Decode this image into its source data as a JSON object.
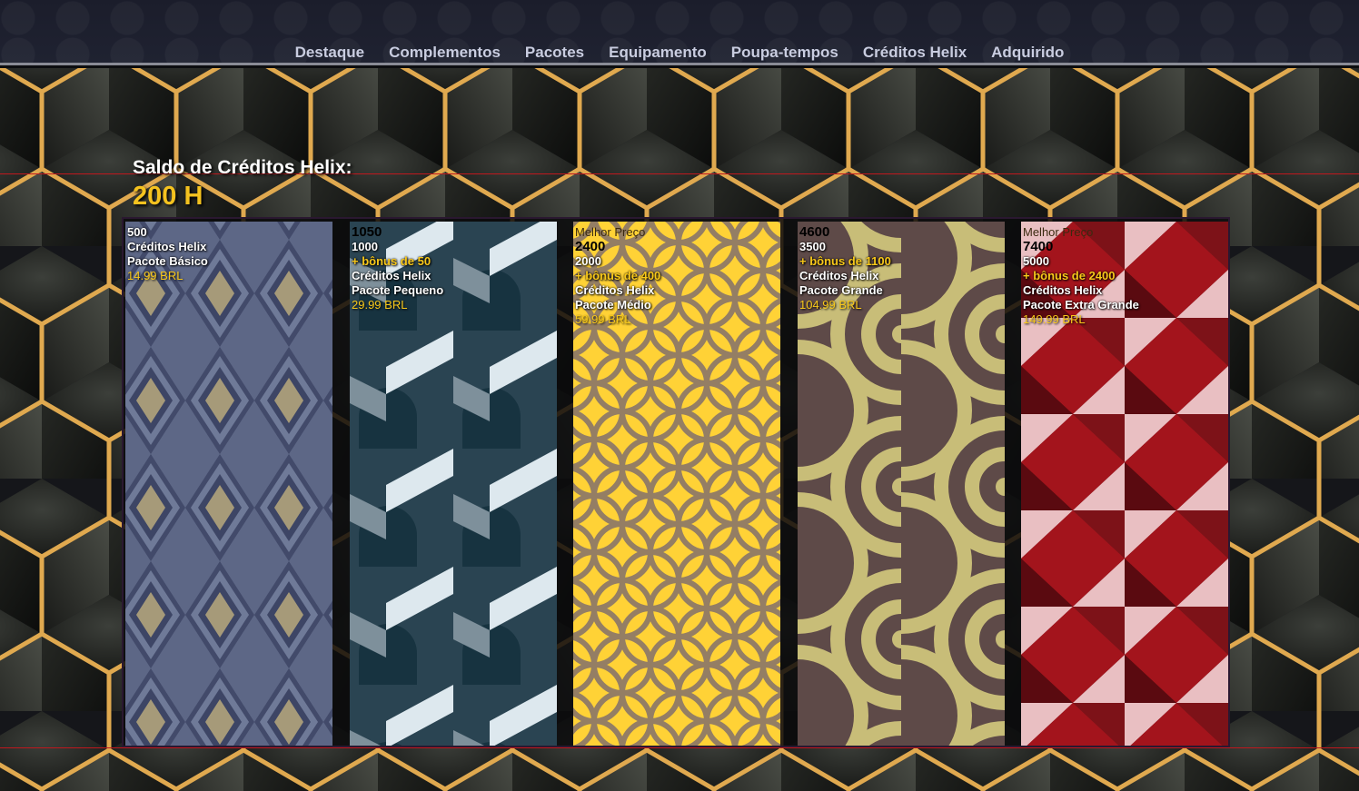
{
  "nav": {
    "items": [
      "Destaque",
      "Complementos",
      "Pacotes",
      "Equipamento",
      "Poupa-tempos",
      "Créditos Helix",
      "Adquirido"
    ]
  },
  "balance": {
    "label": "Saldo de Créditos Helix:",
    "value": "200 H"
  },
  "packs": [
    {
      "badge": "",
      "total": "500",
      "base": "",
      "bonus": "",
      "currency": "Créditos Helix",
      "name": "Pacote Básico",
      "price": "14.99 BRL"
    },
    {
      "badge": "",
      "total": "1050",
      "base": "1000",
      "bonus": "+ bônus de 50",
      "currency": "Créditos Helix",
      "name": "Pacote Pequeno",
      "price": "29.99 BRL"
    },
    {
      "badge": "Melhor Preço",
      "total": "2400",
      "base": "2000",
      "bonus": "+ bônus de 400",
      "currency": "Créditos Helix",
      "name": "Pacote Médio",
      "price": "59.99 BRL"
    },
    {
      "badge": "",
      "total": "4600",
      "base": "3500",
      "bonus": "+ bônus de 1100",
      "currency": "Créditos Helix",
      "name": "Pacote Grande",
      "price": "104.99 BRL"
    },
    {
      "badge": "Melhor Preço",
      "total": "7400",
      "base": "5000",
      "bonus": "+ bônus de 2400",
      "currency": "Créditos Helix",
      "name": "Pacote Extra Grande",
      "price": "149.99 BRL"
    }
  ],
  "colors": {
    "accent": "#f4c21f",
    "nav_text": "#c9cde0",
    "hex_edge": "#e0a94f"
  }
}
